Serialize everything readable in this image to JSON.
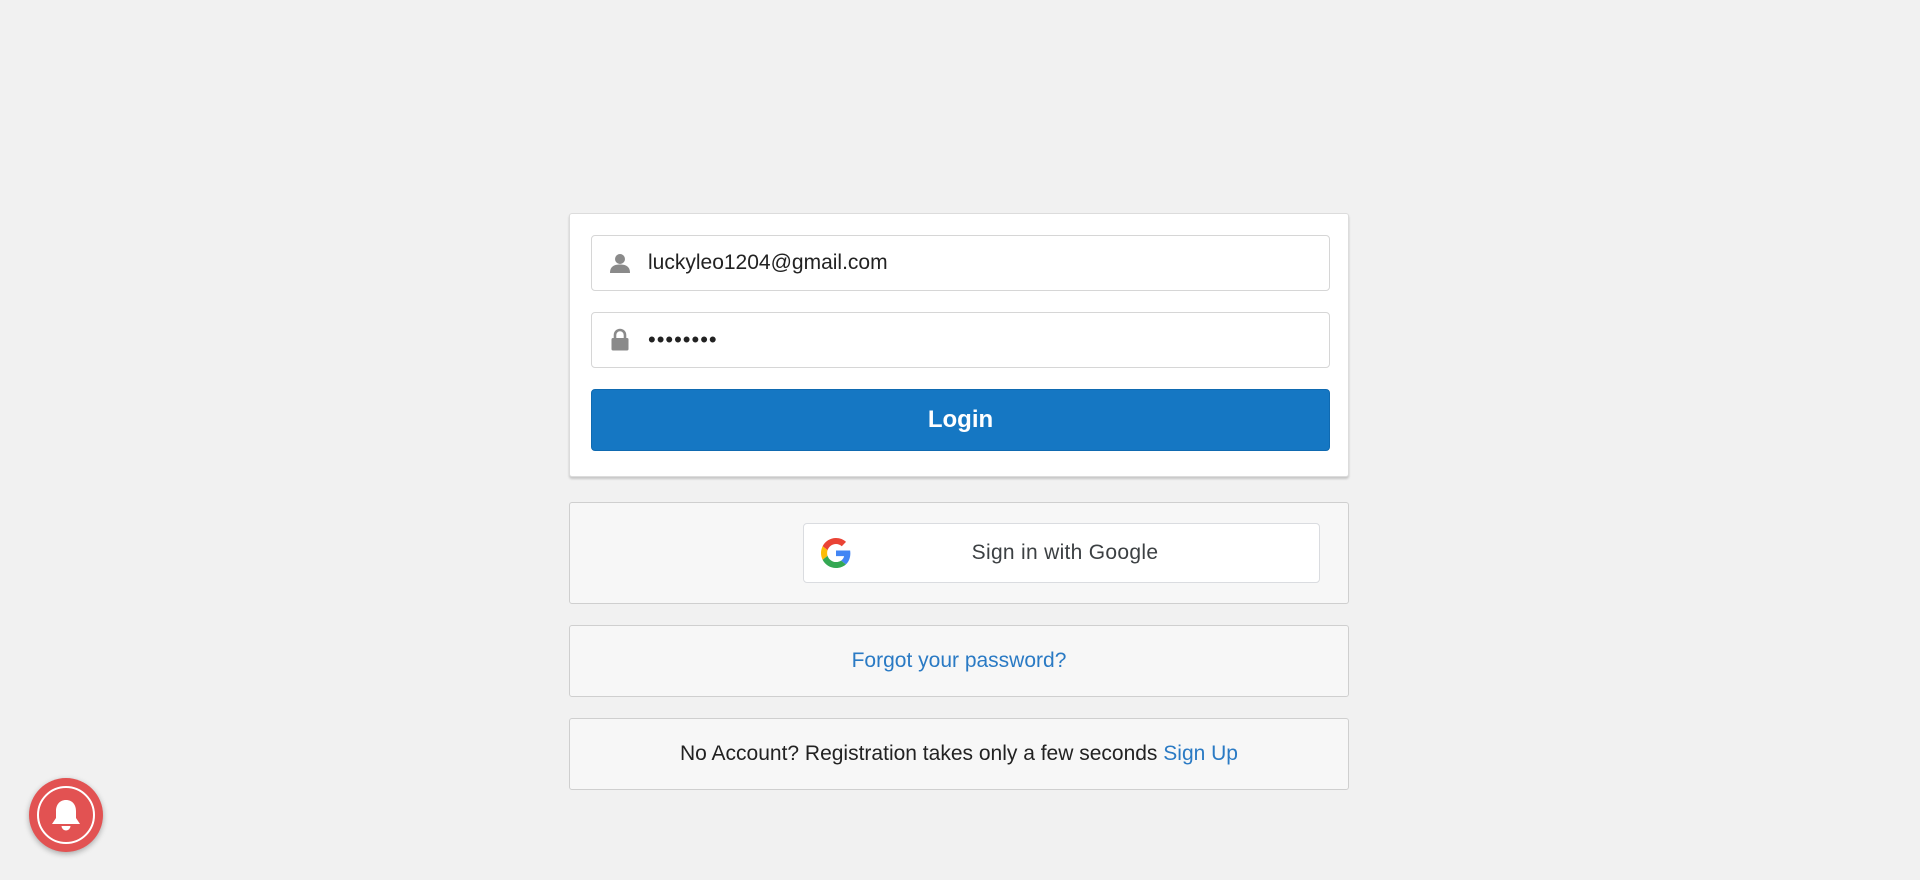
{
  "login_form": {
    "email_value": "luckyleo1204@gmail.com",
    "password_value": "••••••••",
    "login_label": "Login"
  },
  "google": {
    "label": "Sign in with Google"
  },
  "forgot": {
    "label": "Forgot your password?"
  },
  "signup": {
    "prompt": "No Account? Registration takes only a few seconds",
    "link_label": "Sign Up"
  },
  "icons": {
    "email_field": "user-icon",
    "password_field": "lock-icon",
    "google": "google-g-icon",
    "notifications": "bell-icon"
  },
  "colors": {
    "background": "#f1f1f1",
    "primary_button": "#1577c3",
    "link": "#2a7ac4",
    "notification_bell": "#e25252",
    "icon_gray": "#8a8a8a"
  }
}
